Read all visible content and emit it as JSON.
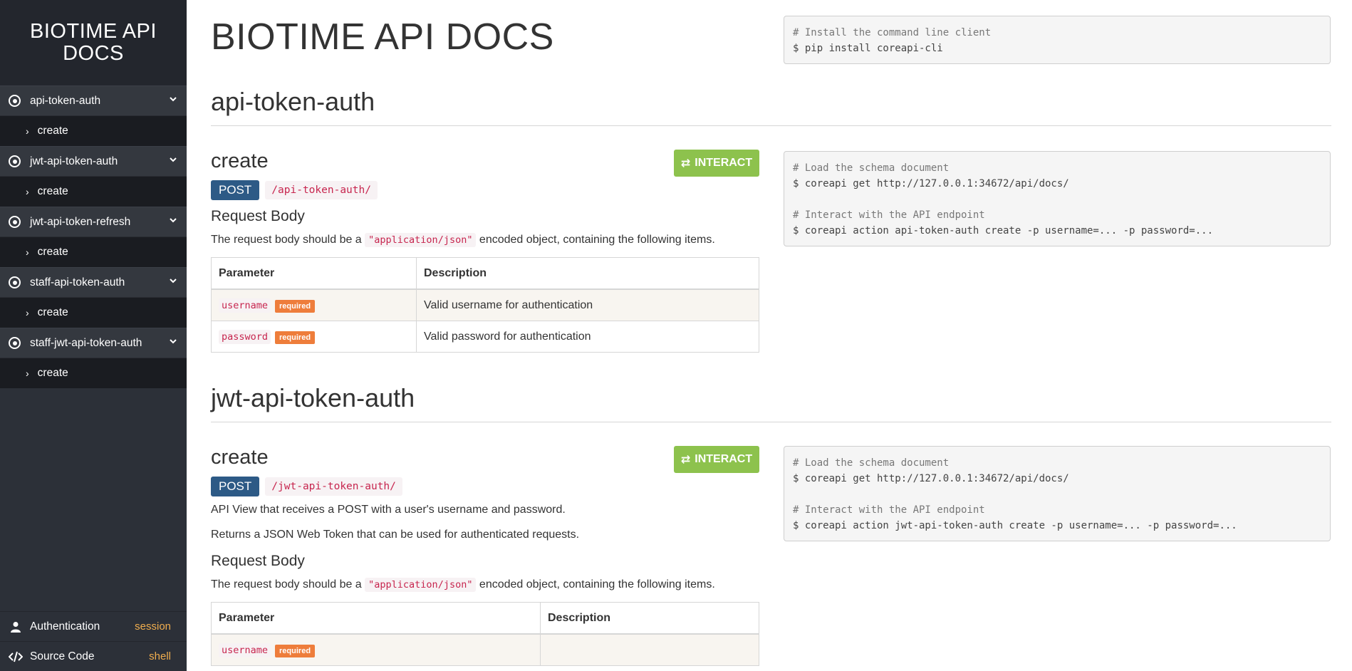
{
  "sidebar": {
    "brand": "BIOTIME API DOCS",
    "groups": [
      {
        "label": "api-token-auth",
        "items": [
          {
            "label": "create"
          }
        ]
      },
      {
        "label": "jwt-api-token-auth",
        "items": [
          {
            "label": "create"
          }
        ]
      },
      {
        "label": "jwt-api-token-refresh",
        "items": [
          {
            "label": "create"
          }
        ]
      },
      {
        "label": "staff-api-token-auth",
        "items": [
          {
            "label": "create"
          }
        ]
      },
      {
        "label": "staff-jwt-api-token-auth",
        "items": [
          {
            "label": "create"
          }
        ]
      }
    ],
    "footer": {
      "auth_label": "Authentication",
      "auth_value": "session",
      "source_label": "Source Code",
      "source_value": "shell"
    }
  },
  "page_title": "BIOTIME API DOCS",
  "install_code": [
    "# Install the command line client",
    "$ pip install coreapi-cli"
  ],
  "sections": [
    {
      "title": "api-token-auth",
      "endpoint_title": "create",
      "interact_label": "INTERACT",
      "method": "POST",
      "path": "/api-token-auth/",
      "description": [],
      "request_body_title": "Request Body",
      "request_body_text_pre": "The request body should be a ",
      "request_body_code": "\"application/json\"",
      "request_body_text_post": " encoded object, containing the following items.",
      "table_headers": [
        "Parameter",
        "Description"
      ],
      "params": [
        {
          "name": "username",
          "badge": "required",
          "description": "Valid username for authentication"
        },
        {
          "name": "password",
          "badge": "required",
          "description": "Valid password for authentication"
        }
      ],
      "code": [
        "# Load the schema document",
        "$ coreapi get http://127.0.0.1:34672/api/docs/",
        "",
        "# Interact with the API endpoint",
        "$ coreapi action api-token-auth create -p username=... -p password=..."
      ]
    },
    {
      "title": "jwt-api-token-auth",
      "endpoint_title": "create",
      "interact_label": "INTERACT",
      "method": "POST",
      "path": "/jwt-api-token-auth/",
      "description": [
        "API View that receives a POST with a user's username and password.",
        "Returns a JSON Web Token that can be used for authenticated requests."
      ],
      "request_body_title": "Request Body",
      "request_body_text_pre": "The request body should be a ",
      "request_body_code": "\"application/json\"",
      "request_body_text_post": " encoded object, containing the following items.",
      "table_headers": [
        "Parameter",
        "Description"
      ],
      "params": [
        {
          "name": "username",
          "badge": "required",
          "description": ""
        }
      ],
      "code": [
        "# Load the schema document",
        "$ coreapi get http://127.0.0.1:34672/api/docs/",
        "",
        "# Interact with the API endpoint",
        "$ coreapi action jwt-api-token-auth create -p username=... -p password=..."
      ]
    }
  ],
  "colors": {
    "sidebar_bg": "#2c3038",
    "brand_bg": "#23262d",
    "interact_green": "#8dc24d",
    "method_blue": "#2d5a86",
    "required_orange": "#ee7d3b",
    "footer_value": "#f0ad4e"
  }
}
